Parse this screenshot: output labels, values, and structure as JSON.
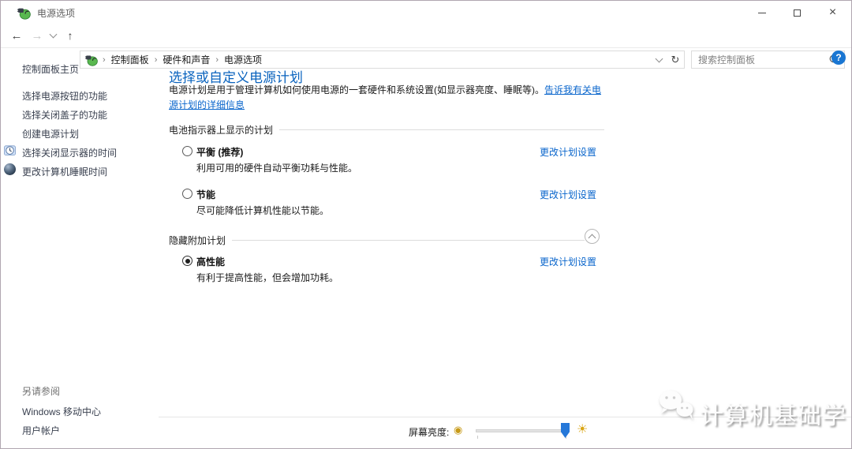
{
  "window": {
    "title": "电源选项"
  },
  "icons": {
    "app": "power-plug",
    "back": "←",
    "forward": "→",
    "up": "↑",
    "nav_dropdown": "chevron-down-css",
    "breadcrumb_separator": "›",
    "refresh": "↻",
    "search": "magnifier",
    "minimize": "css-shape",
    "maximize": "css-shape",
    "close": "×",
    "help": "?",
    "collapse": "chevron-up-css",
    "dim_sun": "◉",
    "bright_sun": "☀"
  },
  "nav": {
    "breadcrumb": [
      {
        "label": "控制面板"
      },
      {
        "label": "硬件和声音"
      },
      {
        "label": "电源选项"
      }
    ],
    "search": {
      "placeholder": "搜索控制面板"
    }
  },
  "sidebar": {
    "home_label": "控制面板主页",
    "tasks": [
      {
        "label": "选择电源按钮的功能"
      },
      {
        "label": "选择关闭盖子的功能"
      },
      {
        "label": "创建电源计划"
      },
      {
        "label": "选择关闭显示器的时间",
        "icon": "clock-icon"
      },
      {
        "label": "更改计算机睡眠时间",
        "icon": "sleep-icon"
      }
    ],
    "see_also_header": "另请参阅",
    "see_also_items": [
      {
        "label": "Windows 移动中心"
      },
      {
        "label": "用户帐户"
      }
    ]
  },
  "main": {
    "title": "选择或自定义电源计划",
    "intro_text": "电源计划是用于管理计算机如何使用电源的一套硬件和系统设置(如显示器亮度、睡眠等)。",
    "intro_link": "告诉我有关电源计划的详细信息",
    "battery_group_label": "电池指示器上显示的计划",
    "hidden_group_label": "隐藏附加计划",
    "plans": [
      {
        "name": "平衡 (推荐)",
        "description": "利用可用的硬件自动平衡功耗与性能。",
        "settings_link": "更改计划设置",
        "selected": false
      },
      {
        "name": "节能",
        "description": "尽可能降低计算机性能以节能。",
        "settings_link": "更改计划设置",
        "selected": false
      },
      {
        "name": "高性能",
        "description": "有利于提高性能，但会增加功耗。",
        "settings_link": "更改计划设置",
        "selected": true
      }
    ]
  },
  "footer": {
    "brightness_label": "屏幕亮度:"
  },
  "watermark": {
    "text": "计算机基础学"
  },
  "colors": {
    "heading": "#0a63be",
    "link": "#0a66cc",
    "help_bg": "#1976d2",
    "slider_thumb": "#2678d9",
    "sun": "#d9a514",
    "plan_icon_green": "#59b84f"
  }
}
